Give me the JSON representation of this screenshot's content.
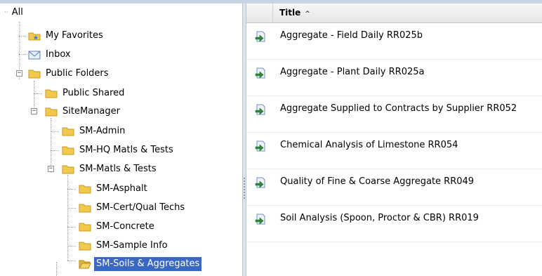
{
  "tree": {
    "root_label": "All",
    "my_favorites": "My Favorites",
    "inbox": "Inbox",
    "public_folders": "Public Folders",
    "public_shared": "Public Shared",
    "sitemanager": "SiteManager",
    "sm_admin": "SM-Admin",
    "sm_hq": "SM-HQ Matls & Tests",
    "sm_matls": "SM-Matls & Tests",
    "sm_asphalt": "SM-Asphalt",
    "sm_cert": "SM-Cert/Qual Techs",
    "sm_concrete": "SM-Concrete",
    "sm_sample": "SM-Sample Info",
    "sm_soils": "SM-Soils & Aggregates"
  },
  "grid": {
    "title_header": "Title",
    "sort_indicator": "^",
    "rows": [
      "Aggregate - Field Daily  RR025b",
      "Aggregate - Plant Daily  RR025a",
      "Aggregate Supplied to Contracts by Supplier  RR052",
      "Chemical Analysis of Limestone  RR054",
      "Quality of Fine & Coarse Aggregate  RR049",
      "Soil Analysis (Spoon, Proctor & CBR)  RR019"
    ]
  },
  "colors": {
    "selection": "#3a67c2",
    "folder": "#f2c94c",
    "report_icon": "#2f8a3a"
  }
}
